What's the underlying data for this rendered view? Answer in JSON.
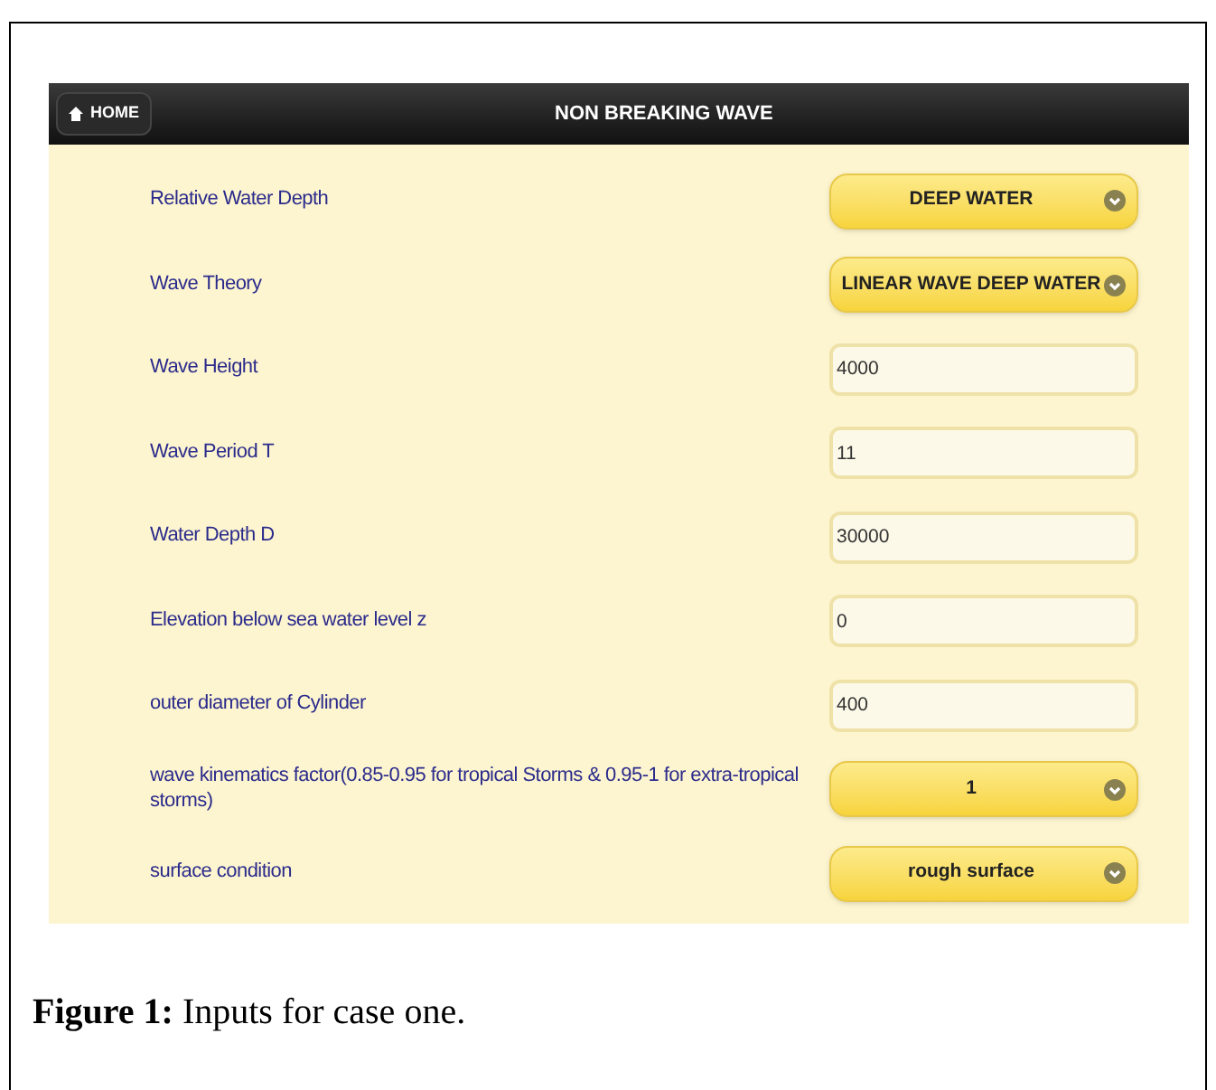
{
  "header": {
    "home_button": "HOME",
    "title": "NON BREAKING WAVE"
  },
  "fields": [
    {
      "label": "Relative Water Depth",
      "kind": "select",
      "value": "DEEP WATER"
    },
    {
      "label": "Wave Theory",
      "kind": "select",
      "value": "LINEAR WAVE DEEP WATER"
    },
    {
      "label": "Wave Height",
      "kind": "input",
      "value": "4000"
    },
    {
      "label": "Wave Period T",
      "kind": "input",
      "value": "11"
    },
    {
      "label": "Water Depth D",
      "kind": "input",
      "value": "30000"
    },
    {
      "label": "Elevation below sea water level z",
      "kind": "input",
      "value": "0"
    },
    {
      "label": "outer diameter of Cylinder",
      "kind": "input",
      "value": "400"
    },
    {
      "label": "wave kinematics factor(0.85-0.95 for tropical Storms & 0.95-1 for extra-tropical storms)",
      "kind": "select",
      "value": "1"
    },
    {
      "label": "surface condition",
      "kind": "select",
      "value": "rough surface"
    }
  ],
  "caption": "**Figure 1:** Inputs for case one."
}
